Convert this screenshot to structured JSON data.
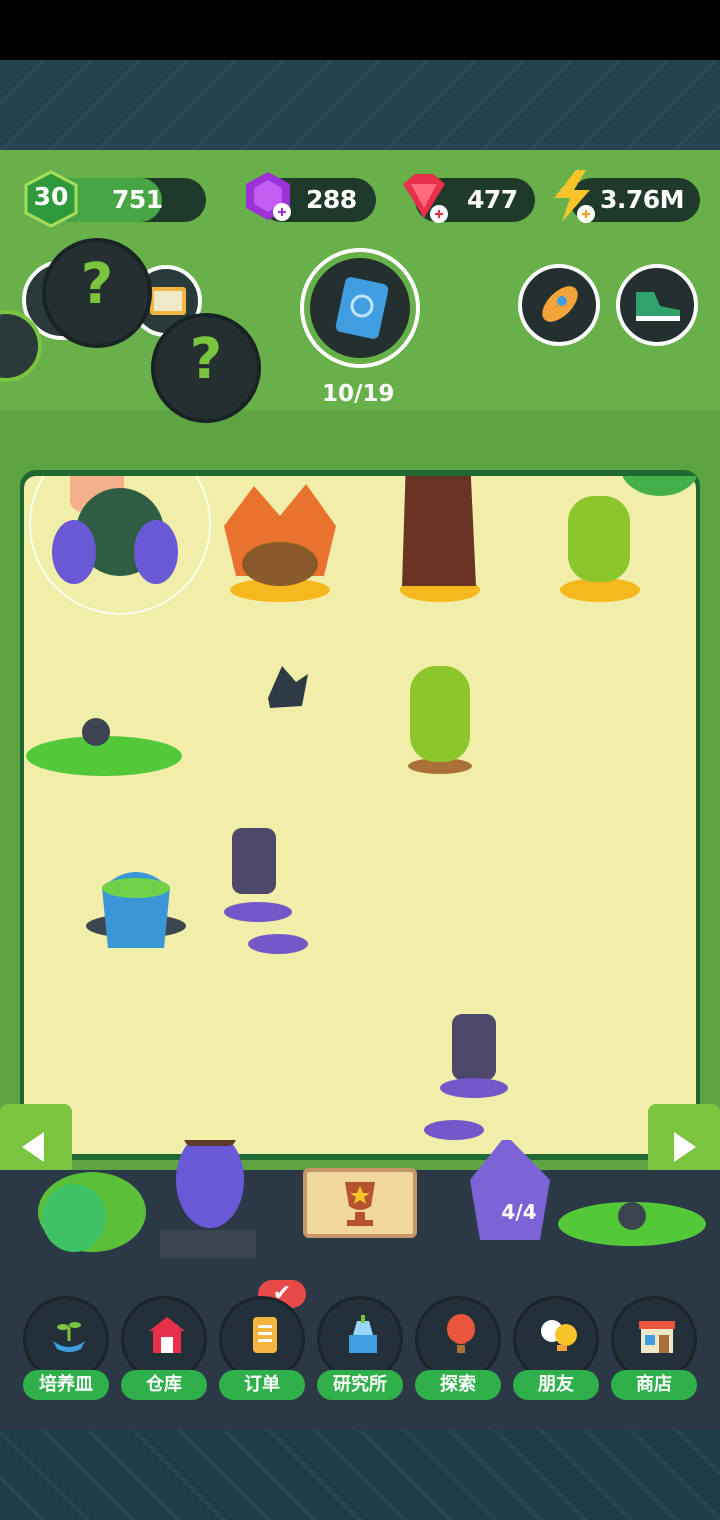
{
  "hud": {
    "level": "30",
    "level_value": "751",
    "level_progress": 0.72,
    "gems_purple": "288",
    "gems_red": "477",
    "energy": "3.76M"
  },
  "collection": {
    "progress_text": "10/19"
  },
  "garden": {
    "vase_count": "4/4"
  },
  "nav": {
    "items": [
      {
        "label": "培养皿",
        "icon": "sprout-dish-icon"
      },
      {
        "label": "仓库",
        "icon": "barn-icon"
      },
      {
        "label": "订单",
        "icon": "order-scroll-icon"
      },
      {
        "label": "研究所",
        "icon": "research-lab-icon"
      },
      {
        "label": "探索",
        "icon": "hot-air-balloon-icon"
      },
      {
        "label": "朋友",
        "icon": "friends-icon"
      },
      {
        "label": "商店",
        "icon": "shop-icon"
      }
    ]
  },
  "colors": {
    "grass": "#5da543",
    "bed": "#f0eea8",
    "accent_green": "#7ac43f",
    "nav_label": "#2fb04a"
  }
}
